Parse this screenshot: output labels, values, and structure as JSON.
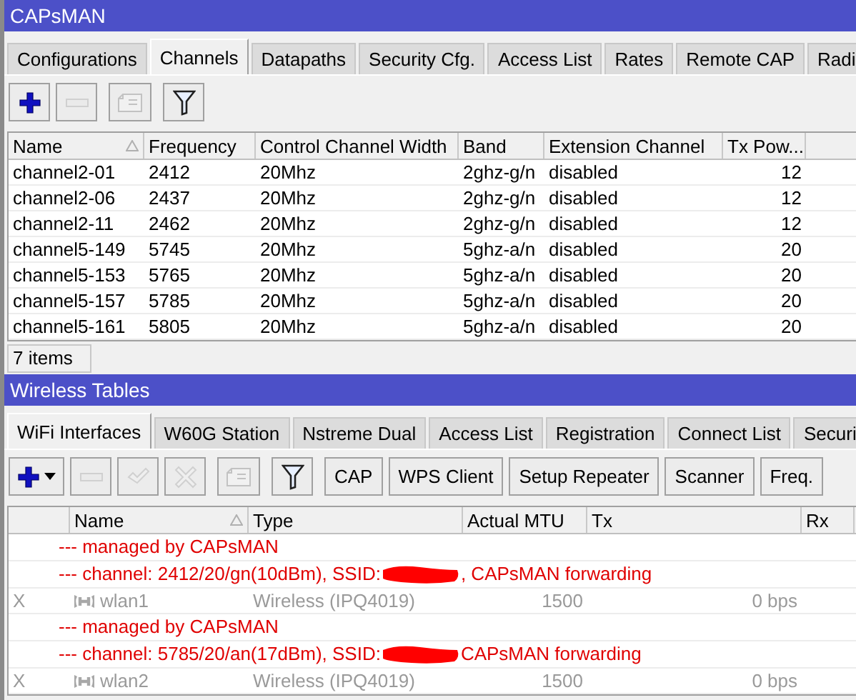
{
  "windows": [
    {
      "title": "CAPsMAN",
      "tabs": [
        {
          "label": "Configurations",
          "selected": false
        },
        {
          "label": "Channels",
          "selected": true
        },
        {
          "label": "Datapaths",
          "selected": false
        },
        {
          "label": "Security Cfg.",
          "selected": false
        },
        {
          "label": "Access List",
          "selected": false
        },
        {
          "label": "Rates",
          "selected": false
        },
        {
          "label": "Remote CAP",
          "selected": false
        },
        {
          "label": "Radi",
          "selected": false
        }
      ],
      "toolbar": [
        {
          "kind": "add",
          "disabled": false
        },
        {
          "kind": "remove",
          "disabled": true
        },
        {
          "kind": "comment",
          "disabled": true
        },
        {
          "kind": "filter",
          "disabled": false
        }
      ],
      "table": {
        "columns": [
          {
            "label": "Name",
            "sorted": true
          },
          {
            "label": "Frequency",
            "sorted": false
          },
          {
            "label": "Control Channel Width",
            "sorted": false
          },
          {
            "label": "Band",
            "sorted": false
          },
          {
            "label": "Extension Channel",
            "sorted": false
          },
          {
            "label": "Tx Pow...",
            "sorted": false,
            "numeric": true
          },
          {}
        ],
        "rows": [
          {
            "kind": "item",
            "disabled": false,
            "cells": [
              "channel2-01",
              "2412",
              "20Mhz",
              "2ghz-g/n",
              "disabled",
              "12"
            ]
          },
          {
            "kind": "item",
            "disabled": false,
            "cells": [
              "channel2-06",
              "2437",
              "20Mhz",
              "2ghz-g/n",
              "disabled",
              "12"
            ]
          },
          {
            "kind": "item",
            "disabled": false,
            "cells": [
              "channel2-11",
              "2462",
              "20Mhz",
              "2ghz-g/n",
              "disabled",
              "12"
            ]
          },
          {
            "kind": "item",
            "disabled": false,
            "cells": [
              "channel5-149",
              "5745",
              "20Mhz",
              "5ghz-a/n",
              "disabled",
              "20"
            ]
          },
          {
            "kind": "item",
            "disabled": false,
            "cells": [
              "channel5-153",
              "5765",
              "20Mhz",
              "5ghz-a/n",
              "disabled",
              "20"
            ]
          },
          {
            "kind": "item",
            "disabled": false,
            "cells": [
              "channel5-157",
              "5785",
              "20Mhz",
              "5ghz-a/n",
              "disabled",
              "20"
            ]
          },
          {
            "kind": "item",
            "disabled": false,
            "cells": [
              "channel5-161",
              "5805",
              "20Mhz",
              "5ghz-a/n",
              "disabled",
              "20"
            ]
          }
        ]
      },
      "status_bar": "7 items"
    },
    {
      "title": "Wireless Tables",
      "tabs": [
        {
          "label": "WiFi Interfaces",
          "selected": true
        },
        {
          "label": "W60G Station",
          "selected": false
        },
        {
          "label": "Nstreme Dual",
          "selected": false
        },
        {
          "label": "Access List",
          "selected": false
        },
        {
          "label": "Registration",
          "selected": false
        },
        {
          "label": "Connect List",
          "selected": false
        },
        {
          "label": "Securi",
          "selected": false
        }
      ],
      "toolbar": [
        {
          "kind": "add-menu",
          "disabled": false
        },
        {
          "kind": "remove",
          "disabled": true
        },
        {
          "kind": "enable",
          "disabled": true
        },
        {
          "kind": "disable",
          "disabled": true
        },
        {
          "kind": "comment",
          "disabled": true
        },
        {
          "kind": "filter",
          "disabled": false
        },
        {
          "kind": "button",
          "label": "CAP"
        },
        {
          "kind": "button",
          "label": "WPS Client"
        },
        {
          "kind": "button",
          "label": "Setup Repeater"
        },
        {
          "kind": "button",
          "label": "Scanner"
        },
        {
          "kind": "button",
          "label": "Freq."
        }
      ],
      "table": {
        "columns": [
          {},
          {
            "label": "Name",
            "sorted": true
          },
          {
            "label": "Type",
            "sorted": false
          },
          {
            "label": "Actual MTU",
            "sorted": false,
            "numeric": true
          },
          {
            "label": "Tx",
            "sorted": false,
            "numeric": true
          },
          {
            "label": "Rx",
            "sorted": false
          }
        ],
        "rows": [
          {
            "kind": "comment",
            "parts": [
              "--- managed by CAPsMAN"
            ]
          },
          {
            "kind": "comment",
            "parts": [
              "--- channel: 2412/20/gn(10dBm), SSID:",
              ", CAPsMAN forwarding"
            ],
            "redacted": true
          },
          {
            "kind": "item",
            "disabled": true,
            "cells": [
              "X",
              "wlan1",
              "Wireless (IPQ4019)",
              "1500",
              "0 bps"
            ]
          },
          {
            "kind": "comment",
            "parts": [
              "--- managed by CAPsMAN"
            ]
          },
          {
            "kind": "comment",
            "parts": [
              "--- channel: 5785/20/an(17dBm), SSID:",
              "CAPsMAN forwarding"
            ],
            "redacted": true
          },
          {
            "kind": "item",
            "disabled": true,
            "cells": [
              "X",
              "wlan2",
              "Wireless (IPQ4019)",
              "1500",
              "0 bps"
            ]
          }
        ]
      }
    }
  ]
}
